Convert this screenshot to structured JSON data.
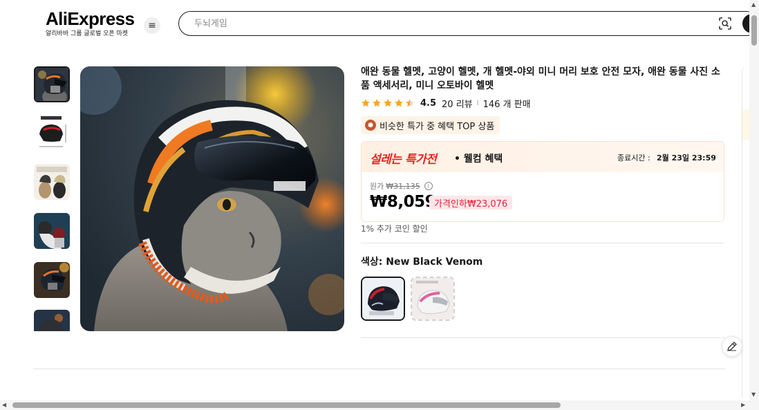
{
  "header": {
    "logo_text": "AliExpress",
    "logo_subtitle": "알리바바 그룹 글로벌 오픈 마켓",
    "search_placeholder": "두뇌게임"
  },
  "icons": {
    "menu": "hamburger-icon",
    "camera_search": "camera-search-icon",
    "edit": "pencil-icon"
  },
  "product": {
    "title": "애완 동물 헬멧, 고양이 헬멧, 개 헬멧-야외 미니 머리 보호 안전 모자, 애완 동물 사진 소품 액세서리, 미니 오토바이 헬멧",
    "rating": "4.5",
    "rating_value": 4.5,
    "review_count": "20 리뷰",
    "separator": "I",
    "sold_count": "146 개 판매",
    "badge_text": "비슷한 특가 중 혜택 TOP 상품"
  },
  "deal": {
    "title": "설레는 특가전",
    "subtitle": "• 웰컴 혜택",
    "end_label": "종료시간 :",
    "end_time": "2월 23일 23:59",
    "original_label": "원가",
    "original_price": "₩31,135",
    "price": "₩8,059",
    "discount_label": "가격인하₩23,076"
  },
  "coin_note": "1% 추가 코인 할인",
  "variant": {
    "label": "색상: New Black Venom",
    "options": [
      "New Black Venom",
      "Pink"
    ]
  },
  "colors": {
    "accent_red": "#e2261f",
    "discount_red": "#e3243b",
    "discount_bg": "#fde7ea",
    "star": "#f6a623",
    "badge_bg": "#fdf3e7"
  }
}
